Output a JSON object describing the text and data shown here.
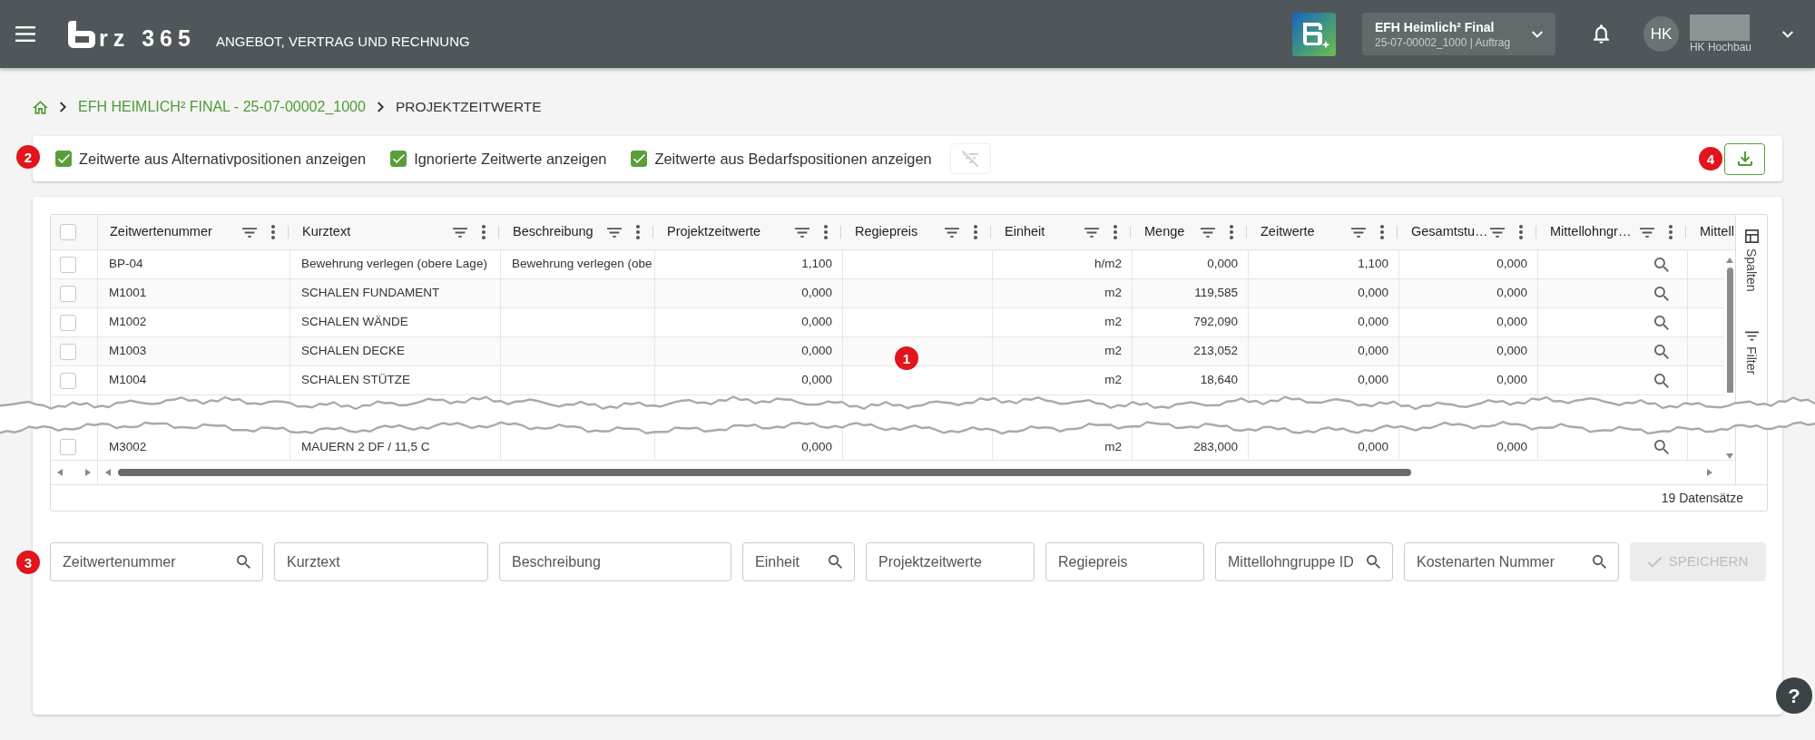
{
  "header": {
    "logo_text": "rz 365",
    "app_title": "ANGEBOT, VERTRAG UND RECHNUNG",
    "project": {
      "title": "EFH Heimlich² Final",
      "subtitle": "25-07-00002_1000 | Auftrag"
    },
    "user": {
      "initials": "HK",
      "company": "HK Hochbau"
    }
  },
  "breadcrumb": [
    {
      "label": "EFH HEIMLICH² FINAL - 25-07-00002_1000",
      "kind": "link"
    },
    {
      "label": "PROJEKTZEITWERTE",
      "kind": "current"
    }
  ],
  "toolbar": {
    "callout": "2",
    "options": [
      {
        "label": "Zeitwerte aus Alternativpositionen anzeigen",
        "checked": true
      },
      {
        "label": "Ignorierte Zeitwerte anzeigen",
        "checked": true
      },
      {
        "label": "Zeitwerte aus Bedarfspositionen anzeigen",
        "checked": true
      }
    ],
    "clear_filter": {
      "disabled": true
    },
    "download": {
      "callout": "4"
    }
  },
  "table": {
    "callout": "1",
    "header_checked": false,
    "columns": [
      {
        "label": "Zeitwertenummer",
        "kind": "text"
      },
      {
        "label": "Kurztext",
        "kind": "text"
      },
      {
        "label": "Beschreibung",
        "kind": "text"
      },
      {
        "label": "Projektzeitwerte",
        "kind": "number"
      },
      {
        "label": "Regiepreis",
        "kind": "number"
      },
      {
        "label": "Einheit",
        "kind": "unit"
      },
      {
        "label": "Menge",
        "kind": "number"
      },
      {
        "label": "Zeitwerte",
        "kind": "number"
      },
      {
        "label": "Gesamtstu…",
        "kind": "number"
      },
      {
        "label": "Mittellohngr…",
        "kind": "lookup"
      },
      {
        "label": "Mittell",
        "kind": "clipped"
      }
    ],
    "rows": [
      {
        "kind": "data",
        "checked": false,
        "cells": [
          "BP-04",
          "Bewehrung verlegen (obere Lage)",
          "Bewehrung verlegen (obe",
          "1,100",
          null,
          "h/m2",
          "0,000",
          "1,100",
          "0,000",
          null,
          null
        ]
      },
      {
        "kind": "data",
        "checked": false,
        "cells": [
          "M1001",
          "SCHALEN FUNDAMENT",
          null,
          "0,000",
          null,
          "m2",
          "119,585",
          "0,000",
          "0,000",
          null,
          null
        ]
      },
      {
        "kind": "data",
        "checked": false,
        "cells": [
          "M1002",
          "SCHALEN WÄNDE",
          null,
          "0,000",
          null,
          "m2",
          "792,090",
          "0,000",
          "0,000",
          null,
          null
        ]
      },
      {
        "kind": "data",
        "checked": false,
        "cells": [
          "M1003",
          "SCHALEN DECKE",
          null,
          "0,000",
          null,
          "m2",
          "213,052",
          "0,000",
          "0,000",
          null,
          null
        ]
      },
      {
        "kind": "data",
        "checked": false,
        "cells": [
          "M1004",
          "SCHALEN STÜTZE",
          null,
          "0,000",
          null,
          "m2",
          "18,640",
          "0,000",
          "0,000",
          null,
          null
        ]
      },
      {
        "kind": "tear"
      },
      {
        "kind": "data",
        "checked": false,
        "cells": [
          "M3002",
          "MAUERN 2 DF / 11,5 C",
          null,
          "0,000",
          null,
          "m2",
          "283,000",
          "0,000",
          "0,000",
          null,
          null
        ]
      }
    ],
    "side_tabs": [
      {
        "label": "Spalten",
        "kind": "columns",
        "selected": false
      },
      {
        "label": "Filter",
        "kind": "filter",
        "selected": false
      }
    ],
    "record_count": "19 Datensätze"
  },
  "entry_form": {
    "callout": "3",
    "fields": [
      {
        "placeholder": "Zeitwertenummer",
        "kind": "search"
      },
      {
        "placeholder": "Kurztext",
        "kind": "text"
      },
      {
        "placeholder": "Beschreibung",
        "kind": "text"
      },
      {
        "placeholder": "Einheit",
        "kind": "search"
      },
      {
        "placeholder": "Projektzeitwerte",
        "kind": "text"
      },
      {
        "placeholder": "Regiepreis",
        "kind": "text"
      },
      {
        "placeholder": "Mittellohngruppe ID",
        "kind": "search"
      },
      {
        "placeholder": "Kostenarten Nummer",
        "kind": "search"
      }
    ],
    "save_button": {
      "label": "SPEICHERN",
      "disabled": true
    }
  },
  "help_button": {
    "label": "?"
  }
}
